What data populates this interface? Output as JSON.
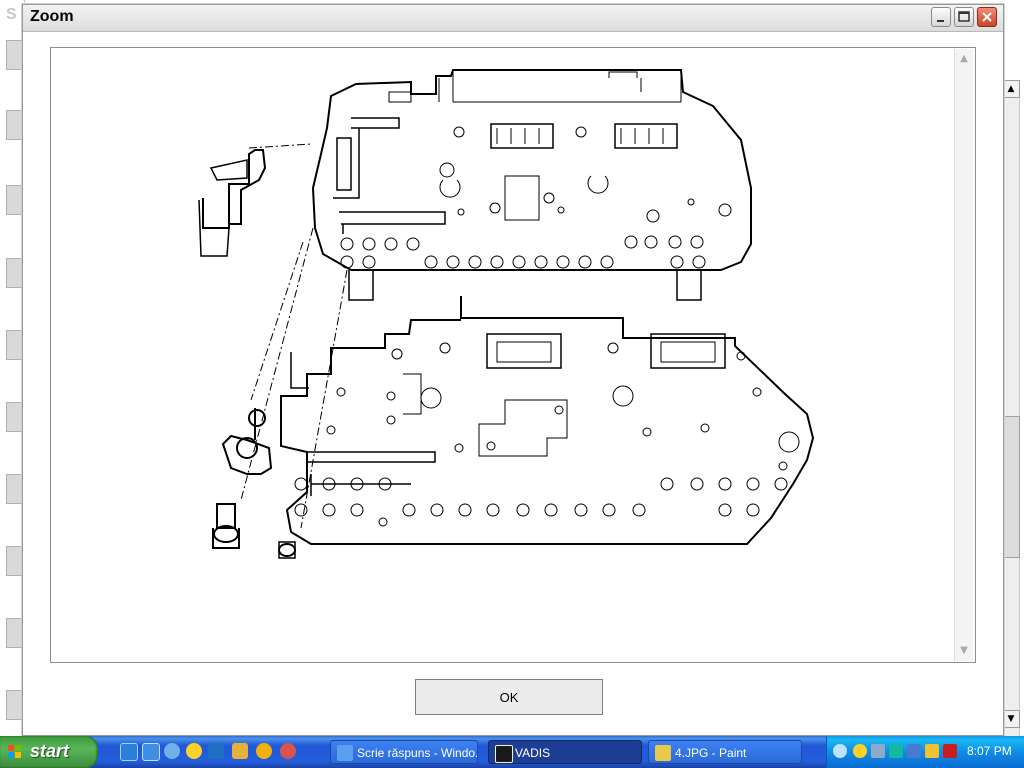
{
  "background_app": {
    "title_stub": "S"
  },
  "dialog": {
    "title": "Zoom",
    "ok_label": "OK"
  },
  "taskbar": {
    "start_label": "start",
    "tasks": [
      {
        "label": "Scrie răspuns - Windo..."
      },
      {
        "label": "VADIS"
      },
      {
        "label": "4.JPG - Paint"
      }
    ],
    "clock": "8:07 PM"
  }
}
